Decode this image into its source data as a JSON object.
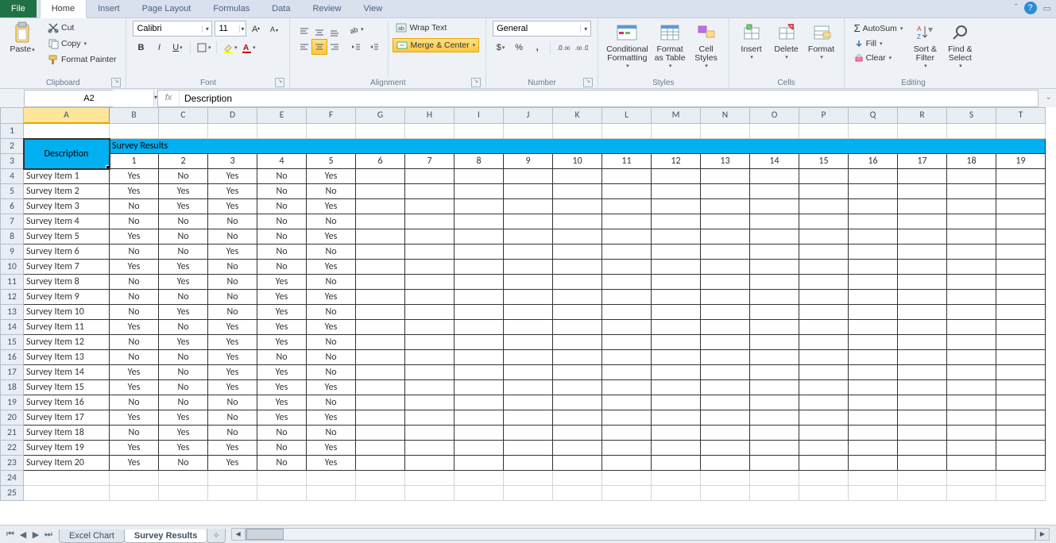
{
  "tabs": {
    "file": "File",
    "home": "Home",
    "insert": "Insert",
    "page_layout": "Page Layout",
    "formulas": "Formulas",
    "data": "Data",
    "review": "Review",
    "view": "View"
  },
  "clipboard": {
    "paste": "Paste",
    "cut": "Cut",
    "copy": "Copy",
    "format_painter": "Format Painter",
    "group": "Clipboard"
  },
  "font": {
    "name": "Calibri",
    "size": "11",
    "group": "Font"
  },
  "alignment": {
    "wrap": "Wrap Text",
    "merge": "Merge & Center",
    "group": "Alignment"
  },
  "number": {
    "format": "General",
    "group": "Number"
  },
  "styles": {
    "cond": "Conditional\nFormatting",
    "table": "Format\nas Table",
    "cell": "Cell\nStyles",
    "group": "Styles"
  },
  "cells": {
    "insert": "Insert",
    "delete": "Delete",
    "format": "Format",
    "group": "Cells"
  },
  "editing": {
    "autosum": "AutoSum",
    "fill": "Fill",
    "clear": "Clear",
    "sort": "Sort &\nFilter",
    "find": "Find &\nSelect",
    "group": "Editing"
  },
  "namebox": "A2",
  "formula": "Description",
  "columns": [
    "A",
    "B",
    "C",
    "D",
    "E",
    "F",
    "G",
    "H",
    "I",
    "J",
    "K",
    "L",
    "M",
    "N",
    "O",
    "P",
    "Q",
    "R",
    "S",
    "T"
  ],
  "sheet": {
    "desc_header": "Description",
    "results_header": "Survey Results",
    "col_nums": [
      "1",
      "2",
      "3",
      "4",
      "5",
      "6",
      "7",
      "8",
      "9",
      "10",
      "11",
      "12",
      "13",
      "14",
      "15",
      "16",
      "17",
      "18",
      "19"
    ],
    "rows": [
      {
        "label": "Survey Item 1",
        "v": [
          "Yes",
          "No",
          "Yes",
          "No",
          "Yes"
        ]
      },
      {
        "label": "Survey Item 2",
        "v": [
          "Yes",
          "Yes",
          "Yes",
          "No",
          "No"
        ]
      },
      {
        "label": "Survey Item 3",
        "v": [
          "No",
          "Yes",
          "Yes",
          "No",
          "Yes"
        ]
      },
      {
        "label": "Survey Item 4",
        "v": [
          "No",
          "No",
          "No",
          "No",
          "No"
        ]
      },
      {
        "label": "Survey Item 5",
        "v": [
          "Yes",
          "No",
          "No",
          "No",
          "Yes"
        ]
      },
      {
        "label": "Survey Item 6",
        "v": [
          "No",
          "No",
          "Yes",
          "No",
          "No"
        ]
      },
      {
        "label": "Survey Item 7",
        "v": [
          "Yes",
          "Yes",
          "No",
          "No",
          "Yes"
        ]
      },
      {
        "label": "Survey Item 8",
        "v": [
          "No",
          "Yes",
          "No",
          "Yes",
          "No"
        ]
      },
      {
        "label": "Survey Item 9",
        "v": [
          "No",
          "No",
          "No",
          "Yes",
          "Yes"
        ]
      },
      {
        "label": "Survey Item 10",
        "v": [
          "No",
          "Yes",
          "No",
          "Yes",
          "No"
        ]
      },
      {
        "label": "Survey Item 11",
        "v": [
          "Yes",
          "No",
          "Yes",
          "Yes",
          "Yes"
        ]
      },
      {
        "label": "Survey Item 12",
        "v": [
          "No",
          "Yes",
          "Yes",
          "Yes",
          "No"
        ]
      },
      {
        "label": "Survey Item 13",
        "v": [
          "No",
          "No",
          "Yes",
          "No",
          "No"
        ]
      },
      {
        "label": "Survey Item 14",
        "v": [
          "Yes",
          "No",
          "Yes",
          "Yes",
          "No"
        ]
      },
      {
        "label": "Survey Item 15",
        "v": [
          "Yes",
          "No",
          "Yes",
          "Yes",
          "Yes"
        ]
      },
      {
        "label": "Survey Item 16",
        "v": [
          "No",
          "No",
          "No",
          "Yes",
          "No"
        ]
      },
      {
        "label": "Survey Item 17",
        "v": [
          "Yes",
          "Yes",
          "No",
          "Yes",
          "Yes"
        ]
      },
      {
        "label": "Survey Item 18",
        "v": [
          "No",
          "Yes",
          "No",
          "No",
          "No"
        ]
      },
      {
        "label": "Survey Item 19",
        "v": [
          "Yes",
          "Yes",
          "Yes",
          "No",
          "Yes"
        ]
      },
      {
        "label": "Survey Item 20",
        "v": [
          "Yes",
          "No",
          "Yes",
          "No",
          "Yes"
        ]
      }
    ]
  },
  "sheet_tabs": {
    "chart": "Excel Chart",
    "results": "Survey Results"
  }
}
